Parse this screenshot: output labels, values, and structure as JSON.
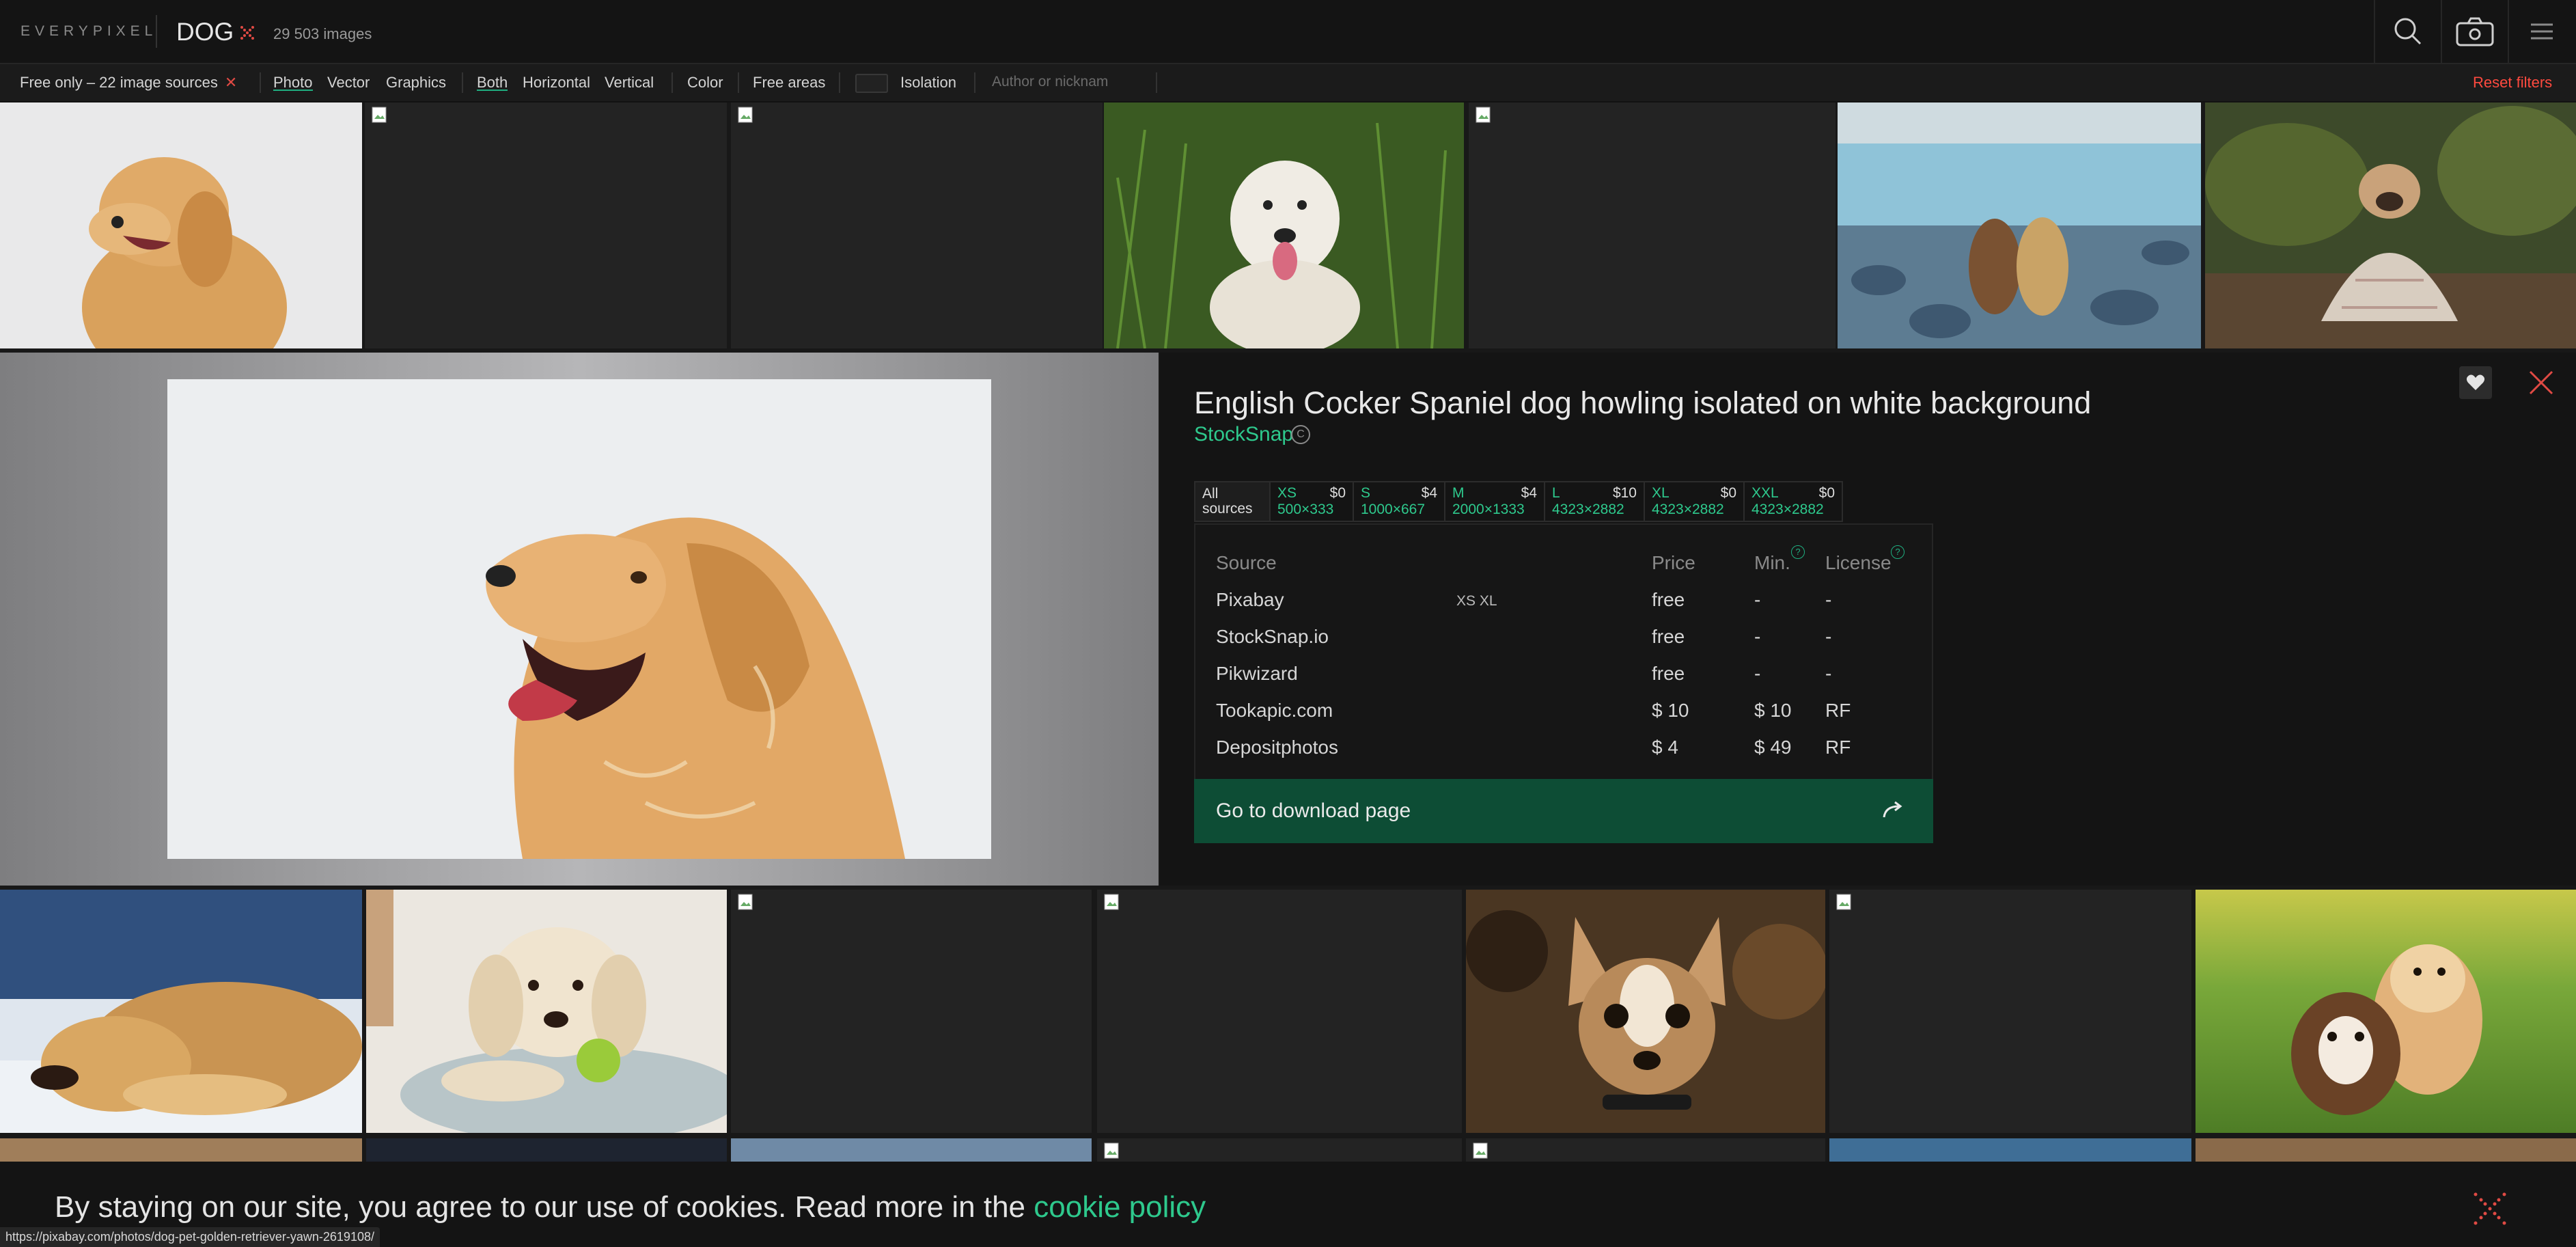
{
  "header": {
    "logo": "EVERYPIXEL",
    "query": "DOG",
    "results_count": "29 503 images"
  },
  "filters": {
    "free_only": "Free only – 22 image sources",
    "type": [
      "Photo",
      "Vector",
      "Graphics"
    ],
    "orientation": [
      "Both",
      "Horizontal",
      "Vertical"
    ],
    "color": "Color",
    "free_areas": "Free areas",
    "isolation": "Isolation",
    "author_placeholder": "Author or nicknam",
    "reset": "Reset filters"
  },
  "detail": {
    "title": "English Cocker Spaniel dog howling isolated on white background",
    "author": "StockSnap",
    "copyright_symbol": "C",
    "sizes": {
      "all": [
        "All",
        "sources"
      ],
      "items": [
        {
          "name": "XS",
          "price": "$0",
          "dims": "500×333"
        },
        {
          "name": "S",
          "price": "$4",
          "dims": "1000×667"
        },
        {
          "name": "M",
          "price": "$4",
          "dims": "2000×1333"
        },
        {
          "name": "L",
          "price": "$10",
          "dims": "4323×2882"
        },
        {
          "name": "XL",
          "price": "$0",
          "dims": "4323×2882"
        },
        {
          "name": "XXL",
          "price": "$0",
          "dims": "4323×2882"
        }
      ]
    },
    "table": {
      "headers": {
        "source": "Source",
        "price": "Price",
        "min": "Min.",
        "license": "License"
      },
      "help": "?",
      "rows": [
        {
          "source": "Pixabay",
          "tags": "XS  XL",
          "price": "free",
          "min": "-",
          "license": "-"
        },
        {
          "source": "StockSnap.io",
          "tags": "",
          "price": "free",
          "min": "-",
          "license": "-"
        },
        {
          "source": "Pikwizard",
          "tags": "",
          "price": "free",
          "min": "-",
          "license": "-"
        },
        {
          "source": "Tookapic.com",
          "tags": "",
          "price": "$ 10",
          "min": "$ 10",
          "license": "RF"
        },
        {
          "source": "Depositphotos",
          "tags": "",
          "price": "$ 4",
          "min": "$ 49",
          "license": "RF"
        }
      ]
    },
    "download_button": "Go to download page"
  },
  "cookie": {
    "text": "By staying on our site, you agree to our use of cookies. Read more in the",
    "link": "cookie policy"
  },
  "status_url": "https://pixabay.com/photos/dog-pet-golden-retriever-yawn-2619108/",
  "colors": {
    "accent": "#2ec98d",
    "download_bg": "#0d4d35",
    "reset": "#ff4a3f"
  }
}
